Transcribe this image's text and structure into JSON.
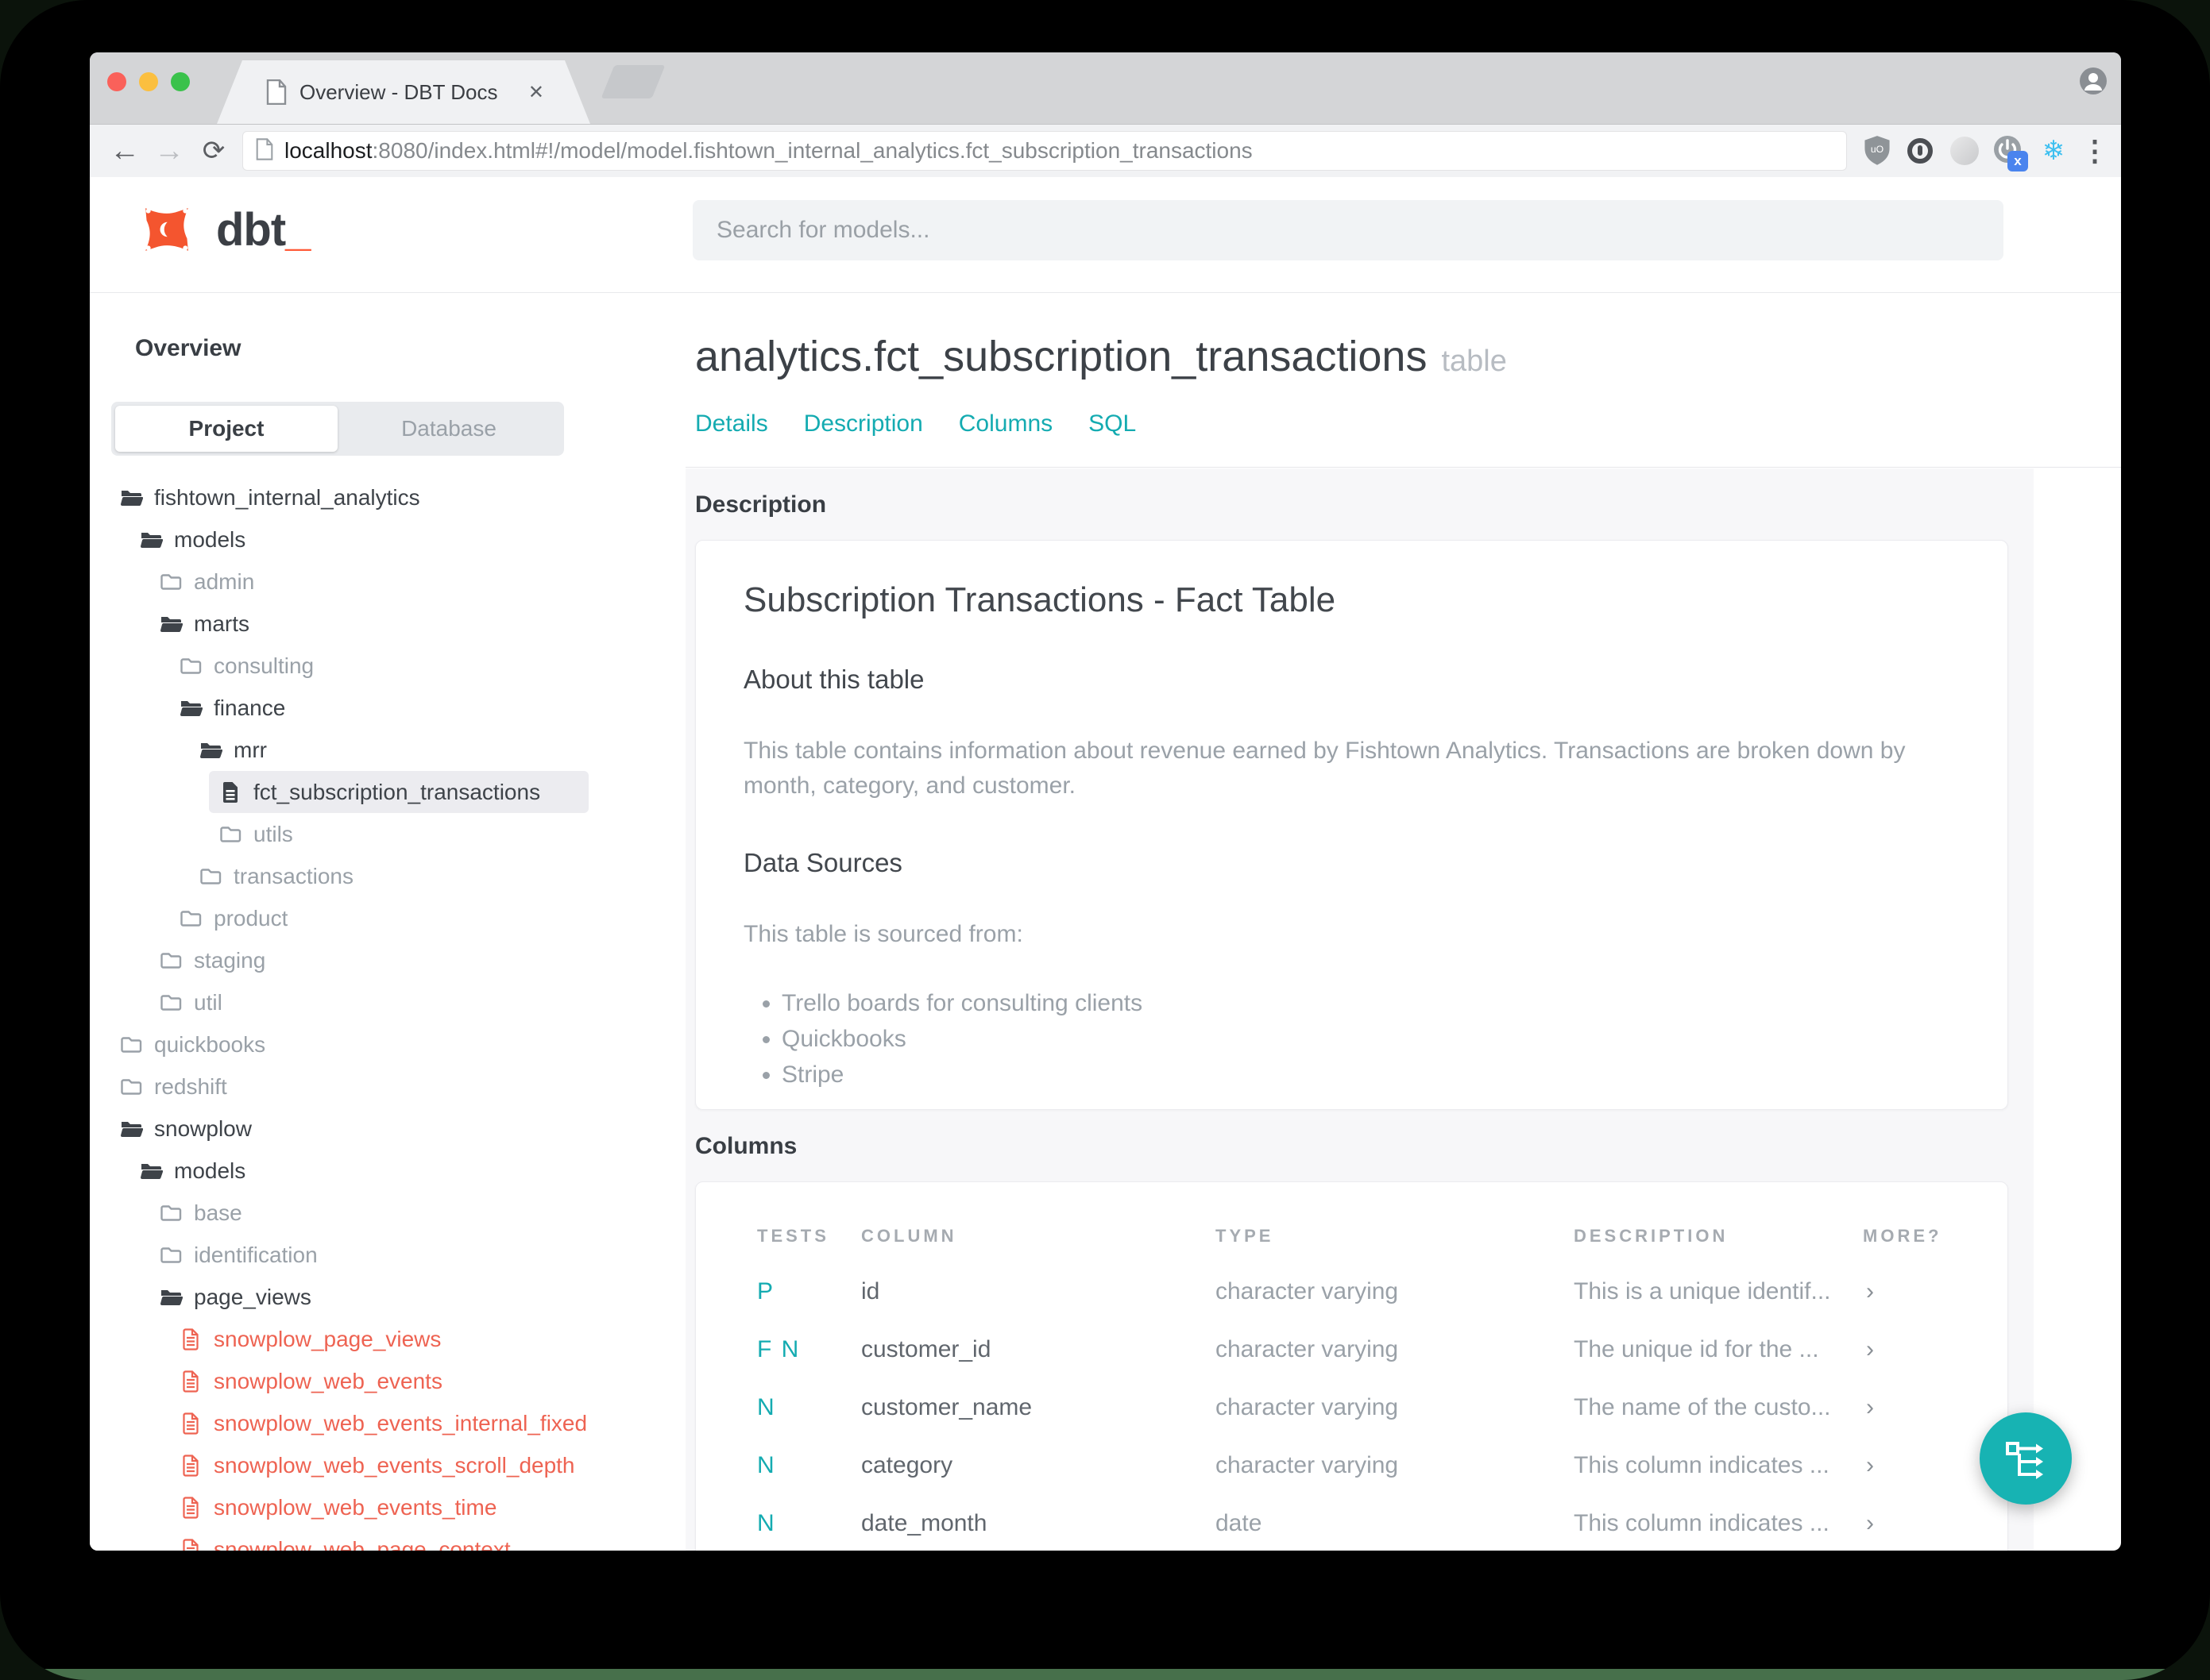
{
  "browser": {
    "tab_title": "Overview - DBT Docs",
    "close_glyph": "✕",
    "back_glyph": "←",
    "forward_glyph": "→",
    "refresh_glyph": "⟳",
    "menu_glyph": "⋮",
    "snowflake_glyph": "❄",
    "url_host": "localhost",
    "url_rest": ":8080/index.html#!/model/model.fishtown_internal_analytics.fct_subscription_transactions"
  },
  "header": {
    "logo_text": "dbt",
    "logo_cursor": "_",
    "search_placeholder": "Search for models..."
  },
  "sidebar": {
    "section_label": "Overview",
    "source_tabs": [
      {
        "label": "Project",
        "active": true
      },
      {
        "label": "Database"
      }
    ],
    "tree": [
      {
        "label": "fishtown_internal_analytics",
        "depth": 0,
        "icon": "folder-open",
        "tone": "dark"
      },
      {
        "label": "models",
        "depth": 1,
        "icon": "folder-open",
        "tone": "dark"
      },
      {
        "label": "admin",
        "depth": 2,
        "icon": "folder-closed",
        "tone": "muted"
      },
      {
        "label": "marts",
        "depth": 2,
        "icon": "folder-open",
        "tone": "dark"
      },
      {
        "label": "consulting",
        "depth": 3,
        "icon": "folder-closed",
        "tone": "muted"
      },
      {
        "label": "finance",
        "depth": 3,
        "icon": "folder-open",
        "tone": "dark"
      },
      {
        "label": "mrr",
        "depth": 4,
        "icon": "folder-open",
        "tone": "dark"
      },
      {
        "label": "fct_subscription_transactions",
        "depth": 5,
        "icon": "file",
        "tone": "dark",
        "selected": true
      },
      {
        "label": "utils",
        "depth": 5,
        "icon": "folder-closed",
        "tone": "muted"
      },
      {
        "label": "transactions",
        "depth": 4,
        "icon": "folder-closed",
        "tone": "muted"
      },
      {
        "label": "product",
        "depth": 3,
        "icon": "folder-closed",
        "tone": "muted"
      },
      {
        "label": "staging",
        "depth": 2,
        "icon": "folder-closed",
        "tone": "muted"
      },
      {
        "label": "util",
        "depth": 2,
        "icon": "folder-closed",
        "tone": "muted"
      },
      {
        "label": "quickbooks",
        "depth": 0,
        "icon": "folder-closed",
        "tone": "muted"
      },
      {
        "label": "redshift",
        "depth": 0,
        "icon": "folder-closed",
        "tone": "muted"
      },
      {
        "label": "snowplow",
        "depth": 0,
        "icon": "folder-open",
        "tone": "dark"
      },
      {
        "label": "models",
        "depth": 1,
        "icon": "folder-open",
        "tone": "dark"
      },
      {
        "label": "base",
        "depth": 2,
        "icon": "folder-closed",
        "tone": "muted"
      },
      {
        "label": "identification",
        "depth": 2,
        "icon": "folder-closed",
        "tone": "muted"
      },
      {
        "label": "page_views",
        "depth": 2,
        "icon": "folder-open",
        "tone": "dark"
      },
      {
        "label": "snowplow_page_views",
        "depth": 3,
        "icon": "file",
        "tone": "accent"
      },
      {
        "label": "snowplow_web_events",
        "depth": 3,
        "icon": "file",
        "tone": "accent"
      },
      {
        "label": "snowplow_web_events_internal_fixed",
        "depth": 3,
        "icon": "file",
        "tone": "accent"
      },
      {
        "label": "snowplow_web_events_scroll_depth",
        "depth": 3,
        "icon": "file",
        "tone": "accent"
      },
      {
        "label": "snowplow_web_events_time",
        "depth": 3,
        "icon": "file",
        "tone": "accent"
      },
      {
        "label": "snowplow_web_page_context",
        "depth": 3,
        "icon": "file",
        "tone": "accent"
      }
    ]
  },
  "main": {
    "title": "analytics.fct_subscription_transactions",
    "title_badge": "table",
    "nav_links": [
      "Details",
      "Description",
      "Columns",
      "SQL"
    ],
    "description_section": {
      "label": "Description",
      "heading": "Subscription Transactions - Fact Table",
      "about_heading": "About this table",
      "about_text": "This table contains information about revenue earned by Fishtown Analytics. Transactions are broken down by month, category, and customer.",
      "sources_heading": "Data Sources",
      "sources_intro": "This table is sourced from:",
      "sources": [
        "Trello boards for consulting clients",
        "Quickbooks",
        "Stripe"
      ]
    },
    "columns_section": {
      "label": "Columns",
      "headers": [
        "TESTS",
        "COLUMN",
        "TYPE",
        "DESCRIPTION",
        "MORE?"
      ],
      "rows": [
        {
          "tests": "P",
          "column": "id",
          "type": "character varying",
          "desc": "This is a unique identif...",
          "more": "›"
        },
        {
          "tests": "F N",
          "column": "customer_id",
          "type": "character varying",
          "desc": "The unique id for the ...",
          "more": "›"
        },
        {
          "tests": "N",
          "column": "customer_name",
          "type": "character varying",
          "desc": "The name of the custo...",
          "more": "›"
        },
        {
          "tests": "N",
          "column": "category",
          "type": "character varying",
          "desc": "This column indicates ...",
          "more": "›"
        },
        {
          "tests": "N",
          "column": "date_month",
          "type": "date",
          "desc": "This column indicates ...",
          "more": "›"
        }
      ]
    }
  },
  "colors": {
    "accent_teal": "#14abb1",
    "accent_red": "#ee6352",
    "logo_orange": "#f4552f",
    "fab_teal": "#17b3b3",
    "wallpaper_green": "#47704b"
  }
}
